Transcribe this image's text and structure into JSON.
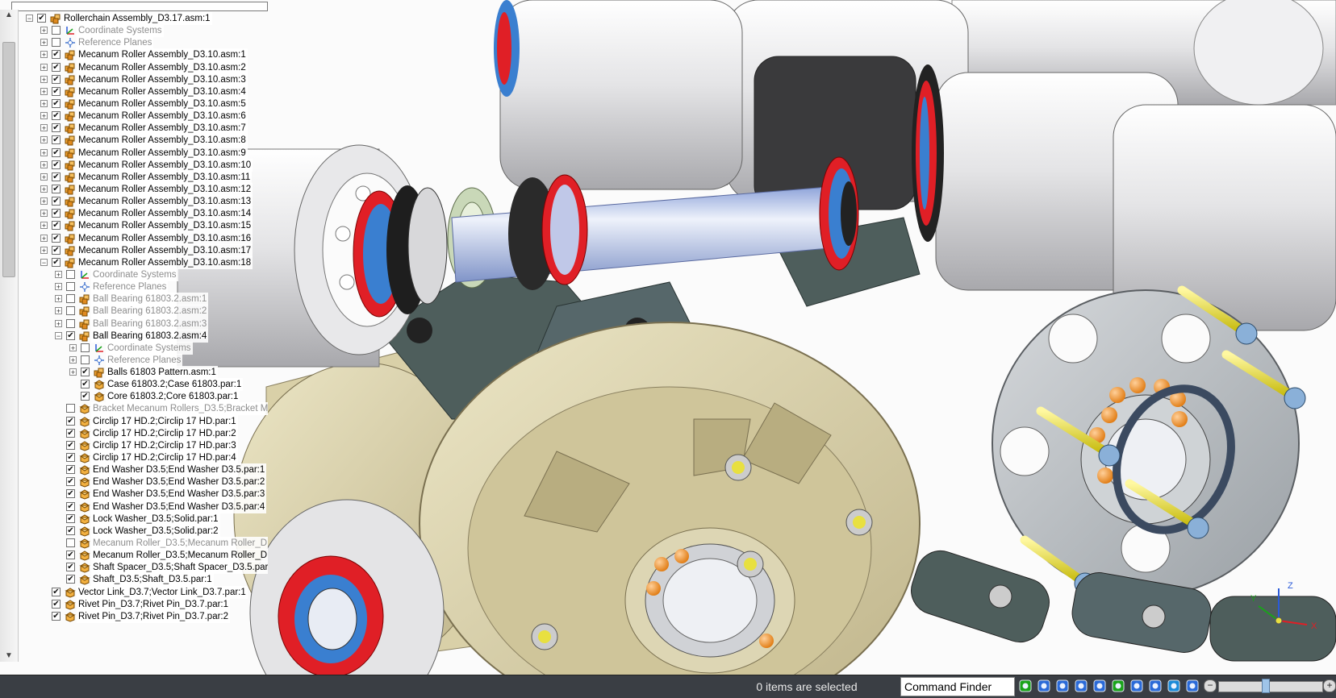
{
  "tree": {
    "rows": [
      {
        "level": 0,
        "label": "Rollerchain Assembly_D3.17.asm:1",
        "checked": true,
        "expander": "-",
        "icon": "assembly",
        "dim": false
      },
      {
        "level": 1,
        "label": "Coordinate Systems",
        "checked": false,
        "expander": "+",
        "icon": "coordsys",
        "dim": true
      },
      {
        "level": 1,
        "label": "Reference Planes",
        "checked": false,
        "expander": "+",
        "icon": "planes",
        "dim": true
      },
      {
        "level": 1,
        "label": "Mecanum Roller Assembly_D3.10.asm:1",
        "checked": true,
        "expander": "+",
        "icon": "assembly",
        "dim": false
      },
      {
        "level": 1,
        "label": "Mecanum Roller Assembly_D3.10.asm:2",
        "checked": true,
        "expander": "+",
        "icon": "assembly",
        "dim": false
      },
      {
        "level": 1,
        "label": "Mecanum Roller Assembly_D3.10.asm:3",
        "checked": true,
        "expander": "+",
        "icon": "assembly",
        "dim": false
      },
      {
        "level": 1,
        "label": "Mecanum Roller Assembly_D3.10.asm:4",
        "checked": true,
        "expander": "+",
        "icon": "assembly",
        "dim": false
      },
      {
        "level": 1,
        "label": "Mecanum Roller Assembly_D3.10.asm:5",
        "checked": true,
        "expander": "+",
        "icon": "assembly",
        "dim": false
      },
      {
        "level": 1,
        "label": "Mecanum Roller Assembly_D3.10.asm:6",
        "checked": true,
        "expander": "+",
        "icon": "assembly",
        "dim": false
      },
      {
        "level": 1,
        "label": "Mecanum Roller Assembly_D3.10.asm:7",
        "checked": true,
        "expander": "+",
        "icon": "assembly",
        "dim": false
      },
      {
        "level": 1,
        "label": "Mecanum Roller Assembly_D3.10.asm:8",
        "checked": true,
        "expander": "+",
        "icon": "assembly",
        "dim": false
      },
      {
        "level": 1,
        "label": "Mecanum Roller Assembly_D3.10.asm:9",
        "checked": true,
        "expander": "+",
        "icon": "assembly",
        "dim": false
      },
      {
        "level": 1,
        "label": "Mecanum Roller Assembly_D3.10.asm:10",
        "checked": true,
        "expander": "+",
        "icon": "assembly",
        "dim": false
      },
      {
        "level": 1,
        "label": "Mecanum Roller Assembly_D3.10.asm:11",
        "checked": true,
        "expander": "+",
        "icon": "assembly",
        "dim": false
      },
      {
        "level": 1,
        "label": "Mecanum Roller Assembly_D3.10.asm:12",
        "checked": true,
        "expander": "+",
        "icon": "assembly",
        "dim": false
      },
      {
        "level": 1,
        "label": "Mecanum Roller Assembly_D3.10.asm:13",
        "checked": true,
        "expander": "+",
        "icon": "assembly",
        "dim": false
      },
      {
        "level": 1,
        "label": "Mecanum Roller Assembly_D3.10.asm:14",
        "checked": true,
        "expander": "+",
        "icon": "assembly",
        "dim": false
      },
      {
        "level": 1,
        "label": "Mecanum Roller Assembly_D3.10.asm:15",
        "checked": true,
        "expander": "+",
        "icon": "assembly",
        "dim": false
      },
      {
        "level": 1,
        "label": "Mecanum Roller Assembly_D3.10.asm:16",
        "checked": true,
        "expander": "+",
        "icon": "assembly",
        "dim": false
      },
      {
        "level": 1,
        "label": "Mecanum Roller Assembly_D3.10.asm:17",
        "checked": true,
        "expander": "+",
        "icon": "assembly",
        "dim": false
      },
      {
        "level": 1,
        "label": "Mecanum Roller Assembly_D3.10.asm:18",
        "checked": true,
        "expander": "-",
        "icon": "assembly",
        "dim": false
      },
      {
        "level": 2,
        "label": "Coordinate Systems",
        "checked": false,
        "expander": "+",
        "icon": "coordsys",
        "dim": true
      },
      {
        "level": 2,
        "label": "Reference Planes",
        "checked": false,
        "expander": "+",
        "icon": "planes",
        "dim": true
      },
      {
        "level": 2,
        "label": "Ball Bearing 61803.2.asm:1",
        "checked": false,
        "expander": "+",
        "icon": "assembly",
        "dim": true
      },
      {
        "level": 2,
        "label": "Ball Bearing 61803.2.asm:2",
        "checked": false,
        "expander": "+",
        "icon": "assembly",
        "dim": true
      },
      {
        "level": 2,
        "label": "Ball Bearing 61803.2.asm:3",
        "checked": false,
        "expander": "+",
        "icon": "assembly",
        "dim": true
      },
      {
        "level": 2,
        "label": "Ball Bearing 61803.2.asm:4",
        "checked": true,
        "expander": "-",
        "icon": "assembly",
        "dim": false
      },
      {
        "level": 3,
        "label": "Coordinate Systems",
        "checked": false,
        "expander": "+",
        "icon": "coordsys",
        "dim": true
      },
      {
        "level": 3,
        "label": "Reference Planes",
        "checked": false,
        "expander": "+",
        "icon": "planes",
        "dim": true
      },
      {
        "level": 3,
        "label": "Balls 61803 Pattern.asm:1",
        "checked": true,
        "expander": "+",
        "icon": "assembly",
        "dim": false
      },
      {
        "level": 3,
        "label": "Case 61803.2;Case 61803.par:1",
        "checked": true,
        "expander": "",
        "icon": "part",
        "dim": false
      },
      {
        "level": 3,
        "label": "Core 61803.2;Core 61803.par:1",
        "checked": true,
        "expander": "",
        "icon": "part",
        "dim": false
      },
      {
        "level": 2,
        "label": "Bracket Mecanum Rollers_D3.5;Bracket M",
        "checked": false,
        "expander": "",
        "icon": "part",
        "dim": true
      },
      {
        "level": 2,
        "label": "Circlip 17 HD.2;Circlip 17 HD.par:1",
        "checked": true,
        "expander": "",
        "icon": "part",
        "dim": false
      },
      {
        "level": 2,
        "label": "Circlip 17 HD.2;Circlip 17 HD.par:2",
        "checked": true,
        "expander": "",
        "icon": "part",
        "dim": false
      },
      {
        "level": 2,
        "label": "Circlip 17 HD.2;Circlip 17 HD.par:3",
        "checked": true,
        "expander": "",
        "icon": "part",
        "dim": false
      },
      {
        "level": 2,
        "label": "Circlip 17 HD.2;Circlip 17 HD.par:4",
        "checked": true,
        "expander": "",
        "icon": "part",
        "dim": false
      },
      {
        "level": 2,
        "label": "End Washer D3.5;End Washer D3.5.par:1",
        "checked": true,
        "expander": "",
        "icon": "part",
        "dim": false
      },
      {
        "level": 2,
        "label": "End Washer D3.5;End Washer D3.5.par:2",
        "checked": true,
        "expander": "",
        "icon": "part",
        "dim": false
      },
      {
        "level": 2,
        "label": "End Washer D3.5;End Washer D3.5.par:3",
        "checked": true,
        "expander": "",
        "icon": "part",
        "dim": false
      },
      {
        "level": 2,
        "label": "End Washer D3.5;End Washer D3.5.par:4",
        "checked": true,
        "expander": "",
        "icon": "part",
        "dim": false
      },
      {
        "level": 2,
        "label": "Lock Washer_D3.5;Solid.par:1",
        "checked": true,
        "expander": "",
        "icon": "part",
        "dim": false
      },
      {
        "level": 2,
        "label": "Lock Washer_D3.5;Solid.par:2",
        "checked": true,
        "expander": "",
        "icon": "part",
        "dim": false
      },
      {
        "level": 2,
        "label": "Mecanum Roller_D3.5;Mecanum Roller_D",
        "checked": false,
        "expander": "",
        "icon": "part",
        "dim": true
      },
      {
        "level": 2,
        "label": "Mecanum Roller_D3.5;Mecanum Roller_D",
        "checked": true,
        "expander": "",
        "icon": "part",
        "dim": false
      },
      {
        "level": 2,
        "label": "Shaft Spacer_D3.5;Shaft Spacer_D3.5.par",
        "checked": true,
        "expander": "",
        "icon": "part",
        "dim": false
      },
      {
        "level": 2,
        "label": "Shaft_D3.5;Shaft_D3.5.par:1",
        "checked": true,
        "expander": "",
        "icon": "part",
        "dim": false
      },
      {
        "level": 1,
        "label": "Vector Link_D3.7;Vector Link_D3.7.par:1",
        "checked": true,
        "expander": "",
        "icon": "part",
        "dim": false
      },
      {
        "level": 1,
        "label": "Rivet Pin_D3.7;Rivet Pin_D3.7.par:1",
        "checked": true,
        "expander": "",
        "icon": "part",
        "dim": false
      },
      {
        "level": 1,
        "label": "Rivet Pin_D3.7;Rivet Pin_D3.7.par:2",
        "checked": true,
        "expander": "",
        "icon": "part",
        "dim": false
      }
    ]
  },
  "status": {
    "selection_text": "0 items are selected",
    "command_finder": "Command Finder",
    "zoom_level": 0.45
  },
  "toolbar": {
    "icons": [
      "refresh-icon",
      "zoom-area-icon",
      "zoom-icon",
      "fit-icon",
      "pan-icon",
      "rotate-icon",
      "look-at-face-icon",
      "view-orientation-icon",
      "shaded-view-icon",
      "view-style-icon"
    ]
  },
  "triad": {
    "x_label": "X",
    "y_label": "Y",
    "z_label": "Z"
  },
  "colors": {
    "status_bar": "#3a3e44",
    "roller": "#e6e6e8",
    "seal_red": "#e01f26",
    "seal_blue": "#3a7fd0",
    "sprocket": "#d8cfa6",
    "bracket": "#4e5e5c",
    "gear": "#b8bcc0",
    "pin": "#e8e040",
    "ball": "#f08c28"
  }
}
